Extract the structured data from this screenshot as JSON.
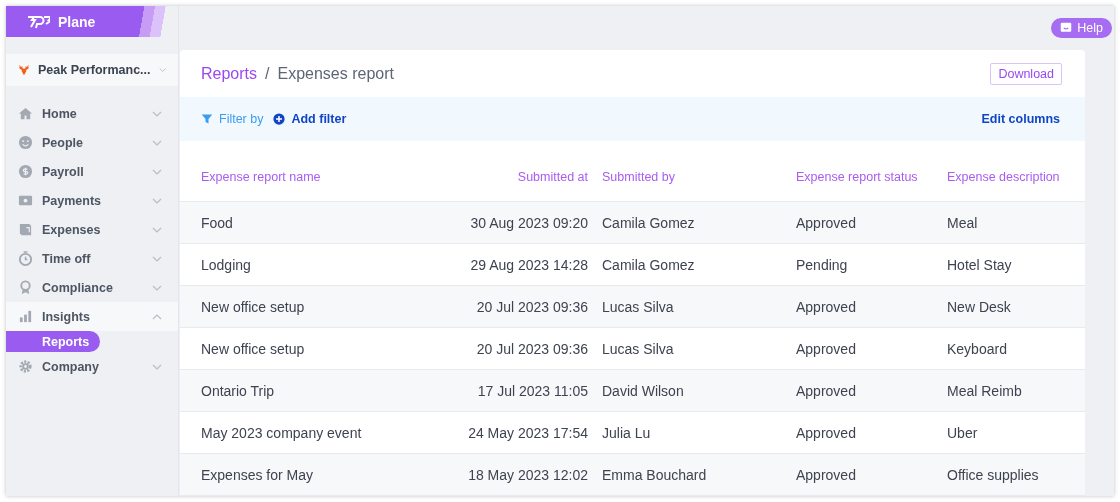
{
  "brand": {
    "name": "Plane"
  },
  "company": {
    "name": "Peak Performanc..."
  },
  "nav": [
    {
      "label": "Home",
      "expanded": false
    },
    {
      "label": "People",
      "expanded": false
    },
    {
      "label": "Payroll",
      "expanded": false
    },
    {
      "label": "Payments",
      "expanded": false
    },
    {
      "label": "Expenses",
      "expanded": false
    },
    {
      "label": "Time off",
      "expanded": false
    },
    {
      "label": "Compliance",
      "expanded": false
    },
    {
      "label": "Insights",
      "expanded": true,
      "children": [
        {
          "label": "Reports",
          "selected": true
        }
      ]
    },
    {
      "label": "Company",
      "expanded": false
    }
  ],
  "help": {
    "label": "Help"
  },
  "breadcrumb": {
    "parent": "Reports",
    "separator": "/",
    "current": "Expenses report"
  },
  "download": "Download",
  "toolbar": {
    "filter_by": "Filter by",
    "add_filter": "Add filter",
    "edit_columns": "Edit columns"
  },
  "table": {
    "columns": [
      "Expense report name",
      "Submitted at",
      "Submitted by",
      "Expense report status",
      "Expense description"
    ],
    "rows": [
      [
        "Food",
        "30 Aug 2023 09:20",
        "Camila Gomez",
        "Approved",
        "Meal"
      ],
      [
        "Lodging",
        "29 Aug 2023 14:28",
        "Camila Gomez",
        "Pending",
        "Hotel Stay"
      ],
      [
        "New office setup",
        "20 Jul 2023 09:36",
        "Lucas Silva",
        "Approved",
        "New Desk"
      ],
      [
        "New office setup",
        "20 Jul 2023 09:36",
        "Lucas Silva",
        "Approved",
        "Keyboard"
      ],
      [
        "Ontario Trip",
        "17 Jul 2023 11:05",
        "David Wilson",
        "Approved",
        "Meal Reimb"
      ],
      [
        "May 2023 company event",
        "24 May 2023 17:54",
        "Julia Lu",
        "Approved",
        "Uber"
      ],
      [
        "Expenses for May",
        "18 May 2023 12:02",
        "Emma Bouchard",
        "Approved",
        "Office supplies"
      ]
    ]
  }
}
